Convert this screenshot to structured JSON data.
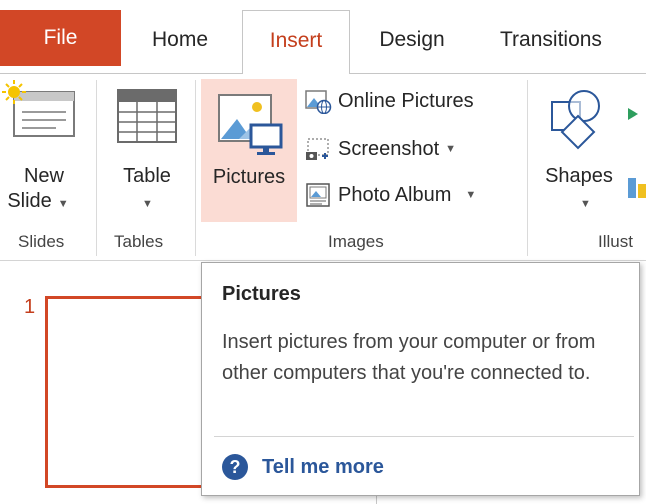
{
  "tabs": {
    "file": "File",
    "home": "Home",
    "insert": "Insert",
    "design": "Design",
    "transitions": "Transitions"
  },
  "ribbon": {
    "slides": {
      "new_slide_line1": "New",
      "new_slide_line2": "Slide",
      "group_label": "Slides"
    },
    "tables": {
      "table_label": "Table",
      "group_label": "Tables"
    },
    "images": {
      "pictures_label": "Pictures",
      "online_pictures_label": "Online Pictures",
      "screenshot_label": "Screenshot",
      "photo_album_label": "Photo Album",
      "group_label": "Images"
    },
    "illustrations": {
      "shapes_label": "Shapes",
      "group_label": "Illust"
    }
  },
  "slide_pane": {
    "slide_number": "1"
  },
  "tooltip": {
    "title": "Pictures",
    "body": "Insert pictures from your computer or from other computers that you're connected to.",
    "help_label": "Tell me more"
  },
  "colors": {
    "accent": "#d24726",
    "insert_tab_text": "#c43e1c",
    "pictures_highlight": "#fbdcd4",
    "help_blue": "#2b579a"
  }
}
